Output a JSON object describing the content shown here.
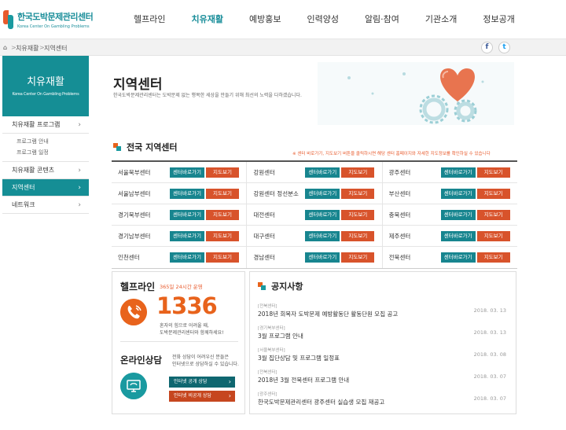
{
  "header": {
    "logo_ko": "한국도박문제관리센터",
    "logo_en": "Korea Center On Gambling Problems",
    "nav": [
      "헬프라인",
      "치유재활",
      "예방홍보",
      "인력양성",
      "알림·참여",
      "기관소개",
      "정보공개"
    ],
    "active_nav": "치유재활"
  },
  "breadcrumb": {
    "home": "⌂",
    "level1": "치유재활",
    "level2": "지역센터",
    "sep": ">"
  },
  "sns": {
    "facebook": "f",
    "twitter": "t"
  },
  "sidebar": {
    "title": "치유재활",
    "subtitle": "Korea Center On Gambling Problems",
    "items": [
      {
        "label": "치유재활 프로그램",
        "arrow": "›"
      },
      {
        "label": "치유재활 콘텐츠",
        "arrow": "›"
      },
      {
        "label": "지역센터",
        "arrow": "›"
      },
      {
        "label": "네트워크",
        "arrow": "›"
      }
    ],
    "subitems": [
      "프로그램 안내",
      "프로그램 일정"
    ]
  },
  "page": {
    "title": "지역센터",
    "description": "한국도박문제관리센터는 도박문제 없는 행복한 세상을 만들기 위해 최선의 노력을 다하겠습니다."
  },
  "centers": {
    "title": "전국 지역센터",
    "note": "※ 센터 바로가기, 지도보기 버튼을 클릭하시면 해당 센터 홈페이지와 자세한 지도정보를 확인하실 수 있습니다",
    "go_label": "센터바로가기",
    "map_label": "지도보기",
    "rows": [
      [
        "서울북부센터",
        "강원센터",
        "광주센터"
      ],
      [
        "서울남부센터",
        "강원센터 정선분소",
        "부산센터"
      ],
      [
        "경기북부센터",
        "대전센터",
        "충북센터"
      ],
      [
        "경기남부센터",
        "대구센터",
        "제주센터"
      ],
      [
        "인천센터",
        "경남센터",
        "전북센터"
      ]
    ]
  },
  "helpline": {
    "title": "헬프라인",
    "hours": "365일 24시간 운영",
    "number": "1336",
    "desc1": "혼자의 힘으로 어려울 때,",
    "desc2": "도박문제관리센터와 함께하세요!"
  },
  "online": {
    "title": "온라인상담",
    "desc1": "전화 상담이 어려우신 분들은",
    "desc2": "인터넷으로 상담하실 수 있습니다.",
    "public_btn": "인터넷 공개 상담",
    "private_btn": "인터넷 비공개 상담",
    "chevron": "›"
  },
  "notice": {
    "title": "공지사항",
    "items": [
      {
        "category": "[전북센터]",
        "title": "2018년 회복자 도박문제 예방활동단 활동단원 모집 공고",
        "date": "2018. 03. 13"
      },
      {
        "category": "[경기북부센터]",
        "title": "3월 프로그램 안내",
        "date": "2018. 03. 13"
      },
      {
        "category": "[서울북부센터]",
        "title": "3월 집단상담 및 프로그램 일정표",
        "date": "2018. 03. 08"
      },
      {
        "category": "[전북센터]",
        "title": "2018년 3월 전북센터 프로그램 안내",
        "date": "2018. 03. 07"
      },
      {
        "category": "[광주센터]",
        "title": "한국도박문제관리센터 광주센터 실습생 모집 재공고",
        "date": "2018. 03. 07"
      }
    ]
  },
  "colors": {
    "teal": "#158e95",
    "orange": "#e8631c",
    "red_btn": "#d8532b"
  }
}
